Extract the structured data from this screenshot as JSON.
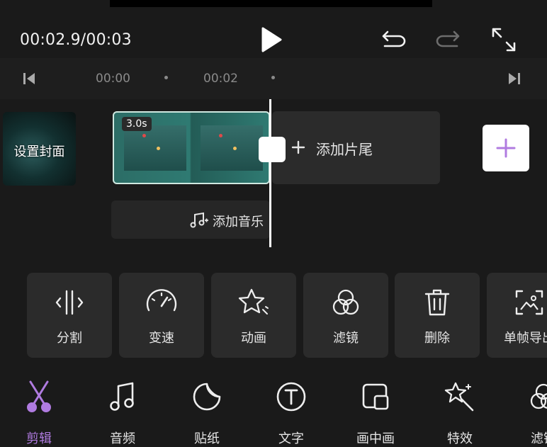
{
  "header": {
    "time_display": "00:02.9/00:03",
    "icons": [
      "play-icon",
      "undo-icon",
      "redo-icon",
      "fullscreen-icon"
    ]
  },
  "ruler": {
    "labels": [
      "00:00",
      "00:02"
    ]
  },
  "timeline": {
    "cover_label": "设置封面",
    "clip_duration": "3.0s",
    "tail_label": "添加片尾",
    "music_label": "添加音乐"
  },
  "tools": [
    {
      "label": "分割",
      "icon": "split-icon"
    },
    {
      "label": "变速",
      "icon": "speed-icon"
    },
    {
      "label": "动画",
      "icon": "animation-icon"
    },
    {
      "label": "滤镜",
      "icon": "filter-icon"
    },
    {
      "label": "删除",
      "icon": "delete-icon"
    },
    {
      "label": "单帧导出",
      "icon": "frame-export-icon"
    }
  ],
  "bottom_nav": [
    {
      "label": "剪辑",
      "icon": "scissors-icon",
      "active": true
    },
    {
      "label": "音频",
      "icon": "music-icon"
    },
    {
      "label": "贴纸",
      "icon": "sticker-icon"
    },
    {
      "label": "文字",
      "icon": "text-icon"
    },
    {
      "label": "画中画",
      "icon": "pip-icon"
    },
    {
      "label": "特效",
      "icon": "effects-icon"
    },
    {
      "label": "滤镜",
      "icon": "filter-icon"
    }
  ],
  "colors": {
    "accent": "#b07be0",
    "background": "#1a1a1a",
    "panel": "#2b2b2b",
    "clip": "#2f7a72"
  }
}
